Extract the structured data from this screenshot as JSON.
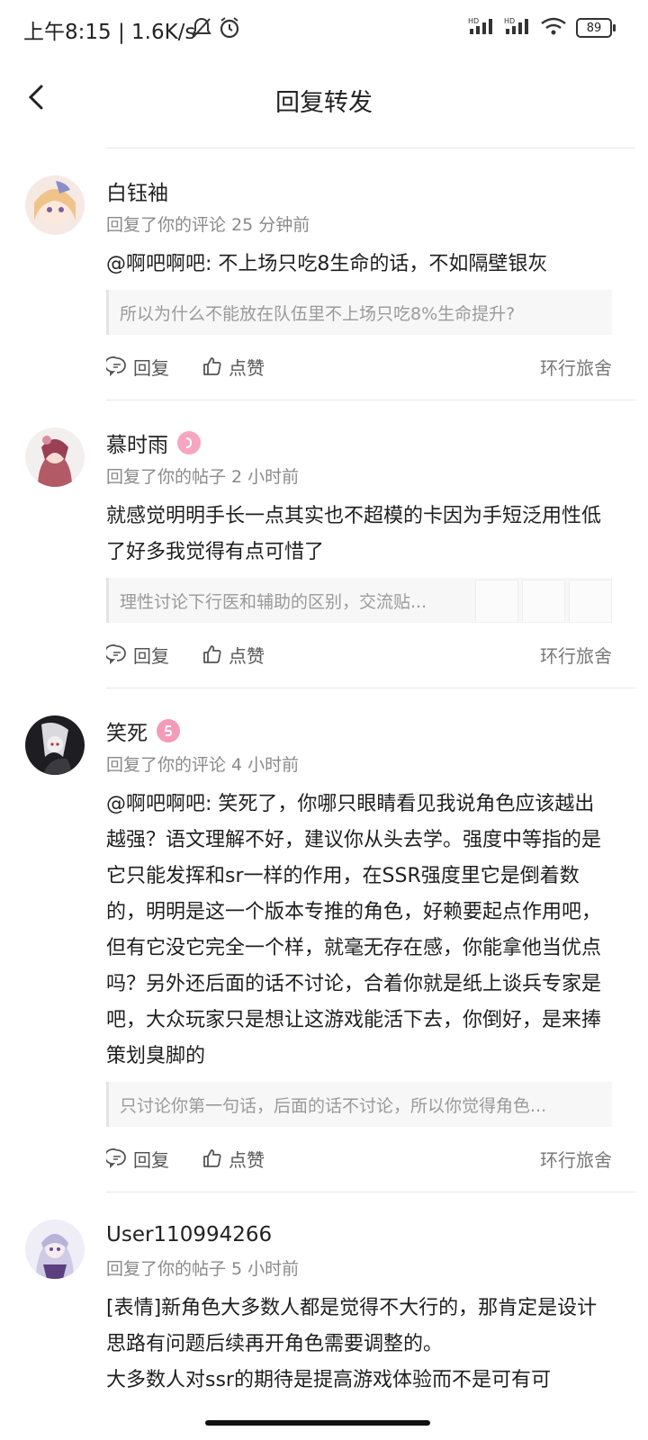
{
  "status": {
    "time_speed": "上午8:15 | 1.6K/s",
    "battery": "89"
  },
  "header": {
    "title": "回复转发"
  },
  "actions": {
    "reply": "回复",
    "like": "点赞"
  },
  "items": [
    {
      "username": "白钰袖",
      "meta": "回复了你的评论 25 分钟前",
      "content": "@啊吧啊吧: 不上场只吃8生命的话，不如隔壁银灰",
      "quote": "所以为什么不能放在队伍里不上场只吃8%生命提升?",
      "source": "环行旅舍"
    },
    {
      "username": "慕时雨",
      "meta": "回复了你的帖子 2 小时前",
      "content": "就感觉明明手长一点其实也不超模的卡因为手短泛用性低了好多我觉得有点可惜了",
      "quote": "理性讨论下行医和辅助的区别，交流贴...",
      "source": "环行旅舍"
    },
    {
      "username": "笑死",
      "meta": "回复了你的评论 4 小时前",
      "content": "@啊吧啊吧: 笑死了，你哪只眼睛看见我说角色应该越出越强？语文理解不好，建议你从头去学。强度中等指的是它只能发挥和sr一样的作用，在SSR强度里它是倒着数的，明明是这一个版本专推的角色，好赖要起点作用吧，但有它没它完全一个样，就毫无存在感，你能拿他当优点吗？另外还后面的话不讨论，合着你就是纸上谈兵专家是吧，大众玩家只是想让这游戏能活下去，你倒好，是来捧策划臭脚的",
      "quote": "只讨论你第一句话，后面的话不讨论，所以你觉得角色...",
      "source": "环行旅舍"
    },
    {
      "username": "User110994266",
      "meta": "回复了你的帖子 5 小时前",
      "content": "[表情]新角色大多数人都是觉得不大行的，那肯定是设计思路有问题后续再开角色需要调整的。\n大多数人对ssr的期待是提高游戏体验而不是可有可"
    }
  ]
}
